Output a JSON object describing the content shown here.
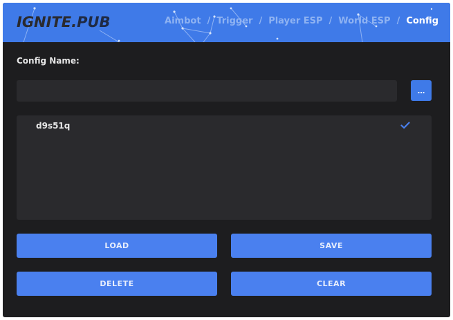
{
  "app": {
    "logo_main": "IGNITE",
    "logo_dot": ".",
    "logo_sub": "PUB",
    "accent_color": "#3f7ae8"
  },
  "nav": {
    "tabs": [
      {
        "label": "Aimbot",
        "active": false
      },
      {
        "label": "Trigger",
        "active": false
      },
      {
        "label": "Player ESP",
        "active": false
      },
      {
        "label": "World ESP",
        "active": false
      },
      {
        "label": "Config",
        "active": true
      }
    ],
    "separator": "/"
  },
  "config": {
    "name_label": "Config Name:",
    "name_value": "",
    "more_button_label": "...",
    "list": [
      {
        "name": "d9s51q",
        "selected": true,
        "icon": "check-icon"
      }
    ]
  },
  "actions": {
    "load_label": "LOAD",
    "save_label": "SAVE",
    "delete_label": "DELETE",
    "clear_label": "CLEAR"
  }
}
